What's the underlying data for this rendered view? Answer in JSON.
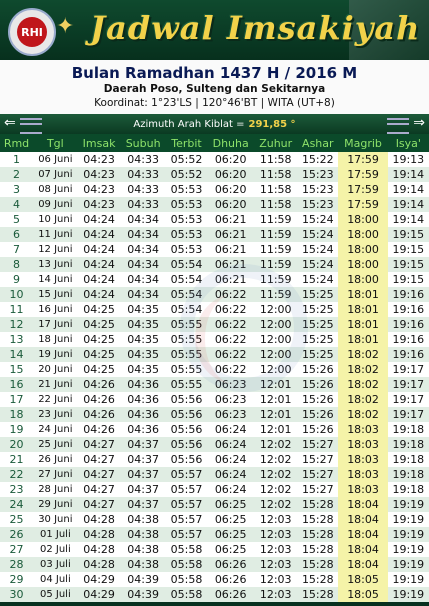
{
  "banner": {
    "logo_text": "RHI",
    "app_title": "Jadwal Imsakiyah"
  },
  "header": {
    "title": "Bulan Ramadhan 1437 H / 2016 M",
    "subtitle": "Daerah Poso, Sulteng dan Sekitarnya",
    "coordinates": "Koordinat: 1°23'LS | 120°46'BT | WITA (UT+8)"
  },
  "kiblat": {
    "label": "Azimuth Arah Kiblat =",
    "value": "291,85 °"
  },
  "table": {
    "columns": [
      "Rmd",
      "Tgl",
      "Imsak",
      "Subuh",
      "Terbit",
      "Dhuha",
      "Zuhur",
      "Ashar",
      "Magrib",
      "Isya'"
    ],
    "rows": [
      [
        "1",
        "06 Juni",
        "04:23",
        "04:33",
        "05:52",
        "06:20",
        "11:58",
        "15:22",
        "17:59",
        "19:13"
      ],
      [
        "2",
        "07 Juni",
        "04:23",
        "04:33",
        "05:52",
        "06:20",
        "11:58",
        "15:23",
        "17:59",
        "19:14"
      ],
      [
        "3",
        "08 Juni",
        "04:23",
        "04:33",
        "05:53",
        "06:20",
        "11:58",
        "15:23",
        "17:59",
        "19:14"
      ],
      [
        "4",
        "09 Juni",
        "04:23",
        "04:33",
        "05:53",
        "06:20",
        "11:58",
        "15:23",
        "17:59",
        "19:14"
      ],
      [
        "5",
        "10 Juni",
        "04:24",
        "04:34",
        "05:53",
        "06:21",
        "11:59",
        "15:24",
        "18:00",
        "19:14"
      ],
      [
        "6",
        "11 Juni",
        "04:24",
        "04:34",
        "05:53",
        "06:21",
        "11:59",
        "15:24",
        "18:00",
        "19:15"
      ],
      [
        "7",
        "12 Juni",
        "04:24",
        "04:34",
        "05:53",
        "06:21",
        "11:59",
        "15:24",
        "18:00",
        "19:15"
      ],
      [
        "8",
        "13 Juni",
        "04:24",
        "04:34",
        "05:54",
        "06:21",
        "11:59",
        "15:24",
        "18:00",
        "19:15"
      ],
      [
        "9",
        "14 Juni",
        "04:24",
        "04:34",
        "05:54",
        "06:21",
        "11:59",
        "15:24",
        "18:00",
        "19:15"
      ],
      [
        "10",
        "15 Juni",
        "04:24",
        "04:34",
        "05:54",
        "06:22",
        "11:59",
        "15:25",
        "18:01",
        "19:16"
      ],
      [
        "11",
        "16 Juni",
        "04:25",
        "04:35",
        "05:54",
        "06:22",
        "12:00",
        "15:25",
        "18:01",
        "19:16"
      ],
      [
        "12",
        "17 Juni",
        "04:25",
        "04:35",
        "05:55",
        "06:22",
        "12:00",
        "15:25",
        "18:01",
        "19:16"
      ],
      [
        "13",
        "18 Juni",
        "04:25",
        "04:35",
        "05:55",
        "06:22",
        "12:00",
        "15:25",
        "18:01",
        "19:16"
      ],
      [
        "14",
        "19 Juni",
        "04:25",
        "04:35",
        "05:55",
        "06:22",
        "12:00",
        "15:25",
        "18:02",
        "19:16"
      ],
      [
        "15",
        "20 Juni",
        "04:25",
        "04:35",
        "05:55",
        "06:22",
        "12:00",
        "15:26",
        "18:02",
        "19:17"
      ],
      [
        "16",
        "21 Juni",
        "04:26",
        "04:36",
        "05:55",
        "06:23",
        "12:01",
        "15:26",
        "18:02",
        "19:17"
      ],
      [
        "17",
        "22 Juni",
        "04:26",
        "04:36",
        "05:56",
        "06:23",
        "12:01",
        "15:26",
        "18:02",
        "19:17"
      ],
      [
        "18",
        "23 Juni",
        "04:26",
        "04:36",
        "05:56",
        "06:23",
        "12:01",
        "15:26",
        "18:02",
        "19:17"
      ],
      [
        "19",
        "24 Juni",
        "04:26",
        "04:36",
        "05:56",
        "06:24",
        "12:01",
        "15:26",
        "18:03",
        "19:18"
      ],
      [
        "20",
        "25 Juni",
        "04:27",
        "04:37",
        "05:56",
        "06:24",
        "12:02",
        "15:27",
        "18:03",
        "19:18"
      ],
      [
        "21",
        "26 Juni",
        "04:27",
        "04:37",
        "05:56",
        "06:24",
        "12:02",
        "15:27",
        "18:03",
        "19:18"
      ],
      [
        "22",
        "27 Juni",
        "04:27",
        "04:37",
        "05:57",
        "06:24",
        "12:02",
        "15:27",
        "18:03",
        "19:18"
      ],
      [
        "23",
        "28 Juni",
        "04:27",
        "04:37",
        "05:57",
        "06:24",
        "12:02",
        "15:27",
        "18:03",
        "19:18"
      ],
      [
        "24",
        "29 Juni",
        "04:27",
        "04:37",
        "05:57",
        "06:25",
        "12:02",
        "15:28",
        "18:04",
        "19:19"
      ],
      [
        "25",
        "30 Juni",
        "04:28",
        "04:38",
        "05:57",
        "06:25",
        "12:03",
        "15:28",
        "18:04",
        "19:19"
      ],
      [
        "26",
        "01 Juli",
        "04:28",
        "04:38",
        "05:57",
        "06:25",
        "12:03",
        "15:28",
        "18:04",
        "19:19"
      ],
      [
        "27",
        "02 Juli",
        "04:28",
        "04:38",
        "05:58",
        "06:25",
        "12:03",
        "15:28",
        "18:04",
        "19:19"
      ],
      [
        "28",
        "03 Juli",
        "04:28",
        "04:38",
        "05:58",
        "06:26",
        "12:03",
        "15:28",
        "18:04",
        "19:19"
      ],
      [
        "29",
        "04 Juli",
        "04:29",
        "04:39",
        "05:58",
        "06:26",
        "12:03",
        "15:28",
        "18:05",
        "19:19"
      ],
      [
        "30",
        "05 Juli",
        "04:29",
        "04:39",
        "05:58",
        "06:26",
        "12:03",
        "15:28",
        "18:05",
        "19:19"
      ]
    ]
  }
}
